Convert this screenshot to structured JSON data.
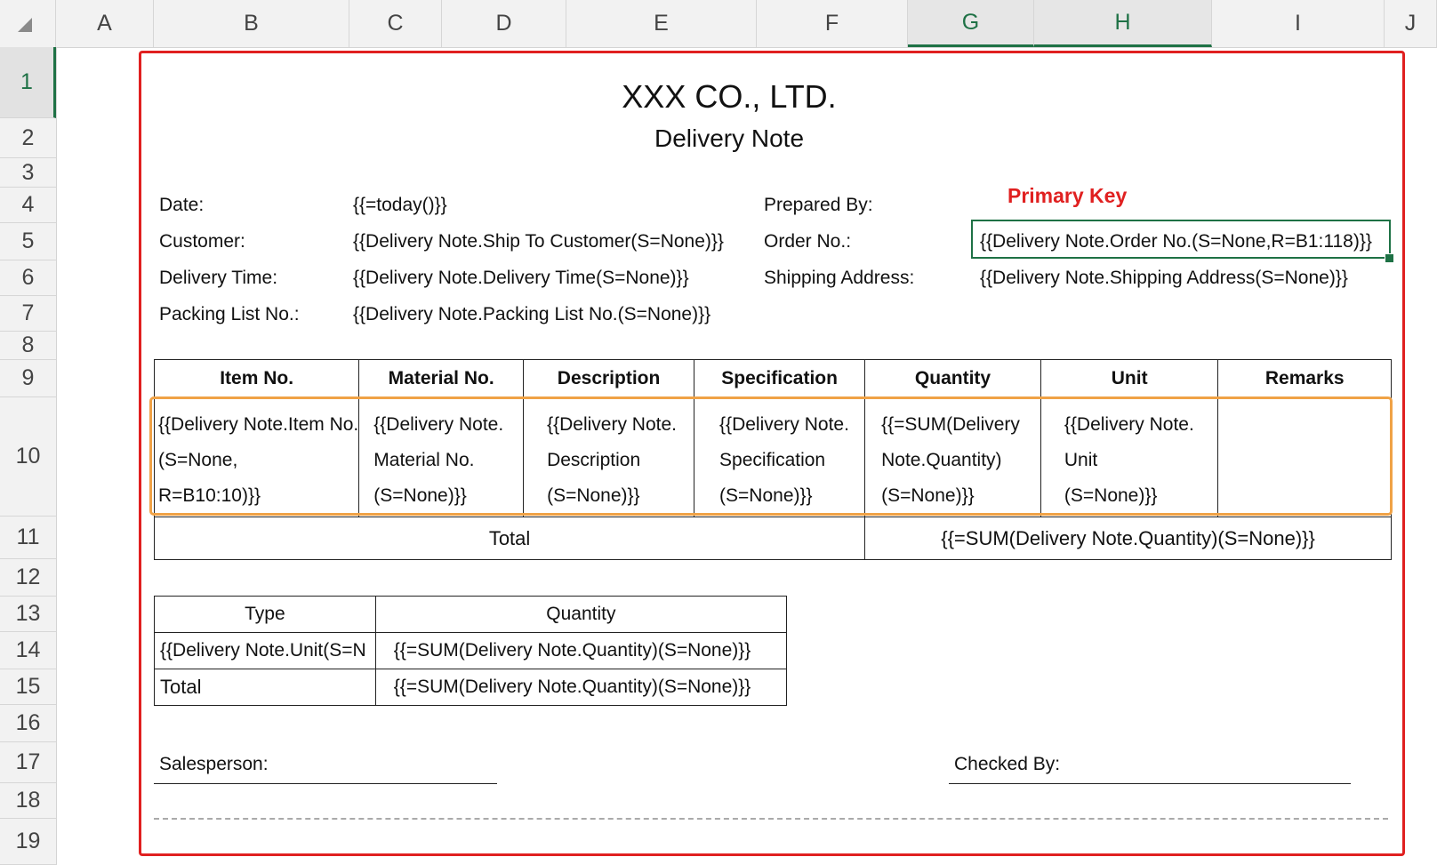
{
  "columns": [
    "A",
    "B",
    "C",
    "D",
    "E",
    "F",
    "G",
    "H",
    "I",
    "J"
  ],
  "rows": [
    "1",
    "2",
    "3",
    "4",
    "5",
    "6",
    "7",
    "8",
    "9",
    "10",
    "11",
    "12",
    "13",
    "14",
    "15",
    "16",
    "17",
    "18",
    "19"
  ],
  "header": {
    "company": "XXX CO., LTD.",
    "doc_title": "Delivery Note"
  },
  "annotation": {
    "primary_key_label": "Primary Key",
    "color": "#e02020"
  },
  "fields": {
    "date_label": "Date:",
    "date_value": "{{=today()}}",
    "customer_label": "Customer:",
    "customer_value": "{{Delivery Note.Ship To Customer(S=None)}}",
    "delivery_time_label": "Delivery Time:",
    "delivery_time_value": "{{Delivery Note.Delivery Time(S=None)}}",
    "packing_label": "Packing List No.:",
    "packing_value": "{{Delivery Note.Packing List No.(S=None)}}",
    "prepared_label": "Prepared By:",
    "order_label": "Order No.:",
    "order_value": "{{Delivery Note.Order No.(S=None,R=B1:118)}}",
    "shipping_label": "Shipping Address:",
    "shipping_value": "{{Delivery Note.Shipping Address(S=None)}}"
  },
  "items_table": {
    "headers": [
      "Item No.",
      "Material No.",
      "Description",
      "Specification",
      "Quantity",
      "Unit",
      "Remarks"
    ],
    "row": [
      [
        "{{Delivery Note.Item No.",
        "(S=None,",
        "R=B10:10)}}"
      ],
      [
        "{{Delivery Note.",
        "Material No.",
        "(S=None)}}"
      ],
      [
        "{{Delivery Note.",
        "Description",
        "(S=None)}}"
      ],
      [
        "{{Delivery Note.",
        "Specification",
        "(S=None)}}"
      ],
      [
        "{{=SUM(Delivery",
        "Note.Quantity)",
        "(S=None)}}"
      ],
      [
        "{{Delivery Note.",
        "Unit",
        "(S=None)}}"
      ],
      [
        "",
        "",
        ""
      ]
    ],
    "total_label": "Total",
    "total_value": "{{=SUM(Delivery Note.Quantity)(S=None)}}"
  },
  "summary_table": {
    "headers": [
      "Type",
      "Quantity"
    ],
    "row1": [
      "{{Delivery Note.Unit(S=N",
      "{{=SUM(Delivery Note.Quantity)(S=None)}}"
    ],
    "row2": [
      "Total",
      "{{=SUM(Delivery Note.Quantity)(S=None)}}"
    ]
  },
  "footer": {
    "salesperson_label": "Salesperson:",
    "checked_label": "Checked By:"
  }
}
